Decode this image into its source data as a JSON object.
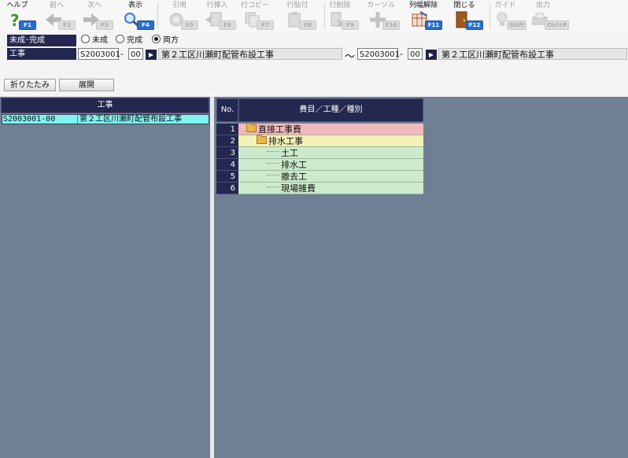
{
  "toolbar": [
    {
      "label": "ヘルプ",
      "key": "F1",
      "icon": "help-icon",
      "enabled": true
    },
    {
      "label": "前へ",
      "key": "F2",
      "icon": "arrow-left-icon",
      "enabled": false
    },
    {
      "label": "次へ",
      "key": "F3",
      "icon": "arrow-right-icon",
      "enabled": false
    },
    {
      "label": "表示",
      "key": "F4",
      "icon": "search-icon",
      "enabled": true
    },
    {
      "label": "引用",
      "key": "F5",
      "icon": "quote-icon",
      "enabled": false
    },
    {
      "label": "行挿入",
      "key": "F6",
      "icon": "row-insert-icon",
      "enabled": false
    },
    {
      "label": "行コピー",
      "key": "F7",
      "icon": "row-copy-icon",
      "enabled": false
    },
    {
      "label": "行貼付",
      "key": "F8",
      "icon": "row-paste-icon",
      "enabled": false
    },
    {
      "label": "行削除",
      "key": "F9",
      "icon": "row-delete-icon",
      "enabled": false
    },
    {
      "label": "カーソル",
      "key": "F10",
      "icon": "cursor-icon",
      "enabled": false
    },
    {
      "label": "列幅解除",
      "key": "F11",
      "icon": "column-width-icon",
      "enabled": true
    },
    {
      "label": "閉じる",
      "key": "F12",
      "icon": "close-door-icon",
      "enabled": true
    },
    {
      "label": "ガイド",
      "key": "Shift",
      "icon": "guide-bulb-icon",
      "enabled": false
    },
    {
      "label": "出力",
      "key": "Ctrl+P",
      "icon": "output-icon",
      "enabled": false
    }
  ],
  "filter": {
    "status_label": "未成･完成",
    "options": [
      "未成",
      "完成",
      "両方"
    ],
    "selected": "両方",
    "project_label": "工事",
    "from_code": "S2003001",
    "from_branch": "00",
    "from_name": "第２工区川瀬町配管布設工事",
    "range_sep": "～",
    "to_code": "S2003001",
    "to_branch": "00",
    "to_name": "第２工区川瀬町配管布設工事",
    "dash": "-",
    "go_symbol": "▶"
  },
  "buttons": {
    "collapse": "折りたたみ",
    "expand": "展開"
  },
  "left": {
    "header": "工事",
    "row_code": "S2003001-00",
    "row_name": "第２工区川瀬町配管布設工事"
  },
  "right": {
    "col_no": "No.",
    "col_name": "費目／工種／種別",
    "rows": [
      {
        "no": "1",
        "name": "直接工事費",
        "level": 0,
        "folder": true,
        "color": "#f2b9bd"
      },
      {
        "no": "2",
        "name": "排水工事",
        "level": 1,
        "folder": true,
        "color": "#f3f1b6"
      },
      {
        "no": "3",
        "name": "土工",
        "level": 2,
        "folder": false,
        "color": "#cceacc"
      },
      {
        "no": "4",
        "name": "排水工",
        "level": 2,
        "folder": false,
        "color": "#cceacc"
      },
      {
        "no": "5",
        "name": "撤去工",
        "level": 2,
        "folder": false,
        "color": "#cceacc"
      },
      {
        "no": "6",
        "name": "現場雑費",
        "level": 2,
        "folder": false,
        "color": "#cceacc"
      }
    ]
  }
}
